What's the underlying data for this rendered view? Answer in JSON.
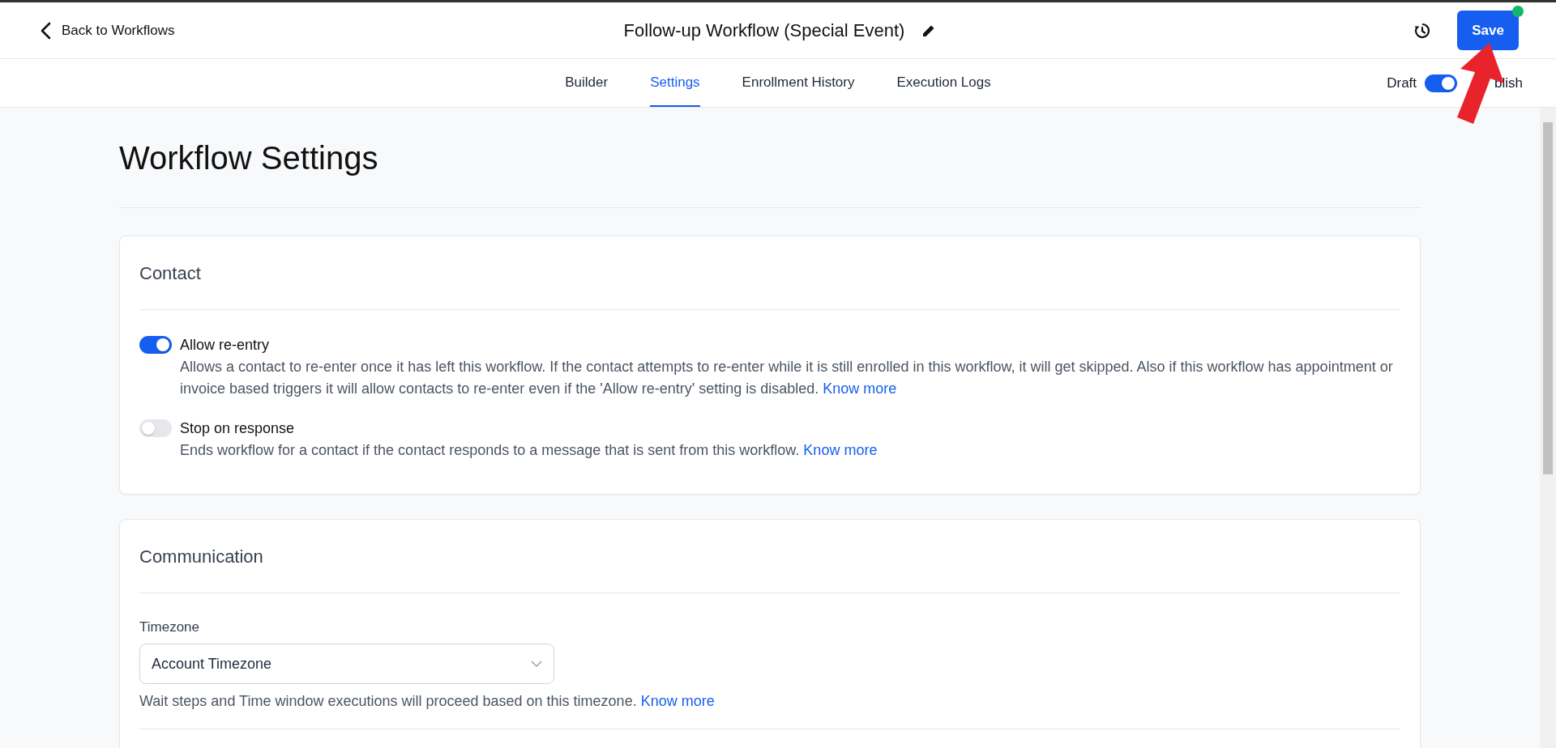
{
  "header": {
    "back_label": "Back to Workflows",
    "title": "Follow-up Workflow (Special Event)",
    "save_label": "Save",
    "unsaved": true
  },
  "tabs": [
    {
      "label": "Builder",
      "selected": false
    },
    {
      "label": "Settings",
      "selected": true
    },
    {
      "label": "Enrollment History",
      "selected": false
    },
    {
      "label": "Execution Logs",
      "selected": false
    }
  ],
  "publish": {
    "draft_label": "Draft",
    "publish_label": "blish",
    "on": true
  },
  "page_title": "Workflow Settings",
  "sections": [
    {
      "title": "Contact",
      "items": [
        {
          "kind": "toggle",
          "label": "Allow re-entry",
          "on": true,
          "description": "Allows a contact to re-enter once it has left this workflow. If the contact attempts to re-enter while it is still enrolled in this workflow, it will get skipped. Also if this workflow has appointment or invoice based triggers it will allow contacts to re-enter even if the 'Allow re-entry' setting is disabled.",
          "link": "Know more"
        },
        {
          "kind": "toggle",
          "label": "Stop on response",
          "on": false,
          "description": "Ends workflow for a contact if the contact responds to a message that is sent from this workflow.",
          "link": "Know more"
        }
      ]
    },
    {
      "title": "Communication",
      "items": [
        {
          "kind": "select",
          "label": "Timezone",
          "value": "Account Timezone",
          "description": "Wait steps and Time window executions will proceed based on this timezone.",
          "link": "Know more"
        }
      ]
    }
  ]
}
